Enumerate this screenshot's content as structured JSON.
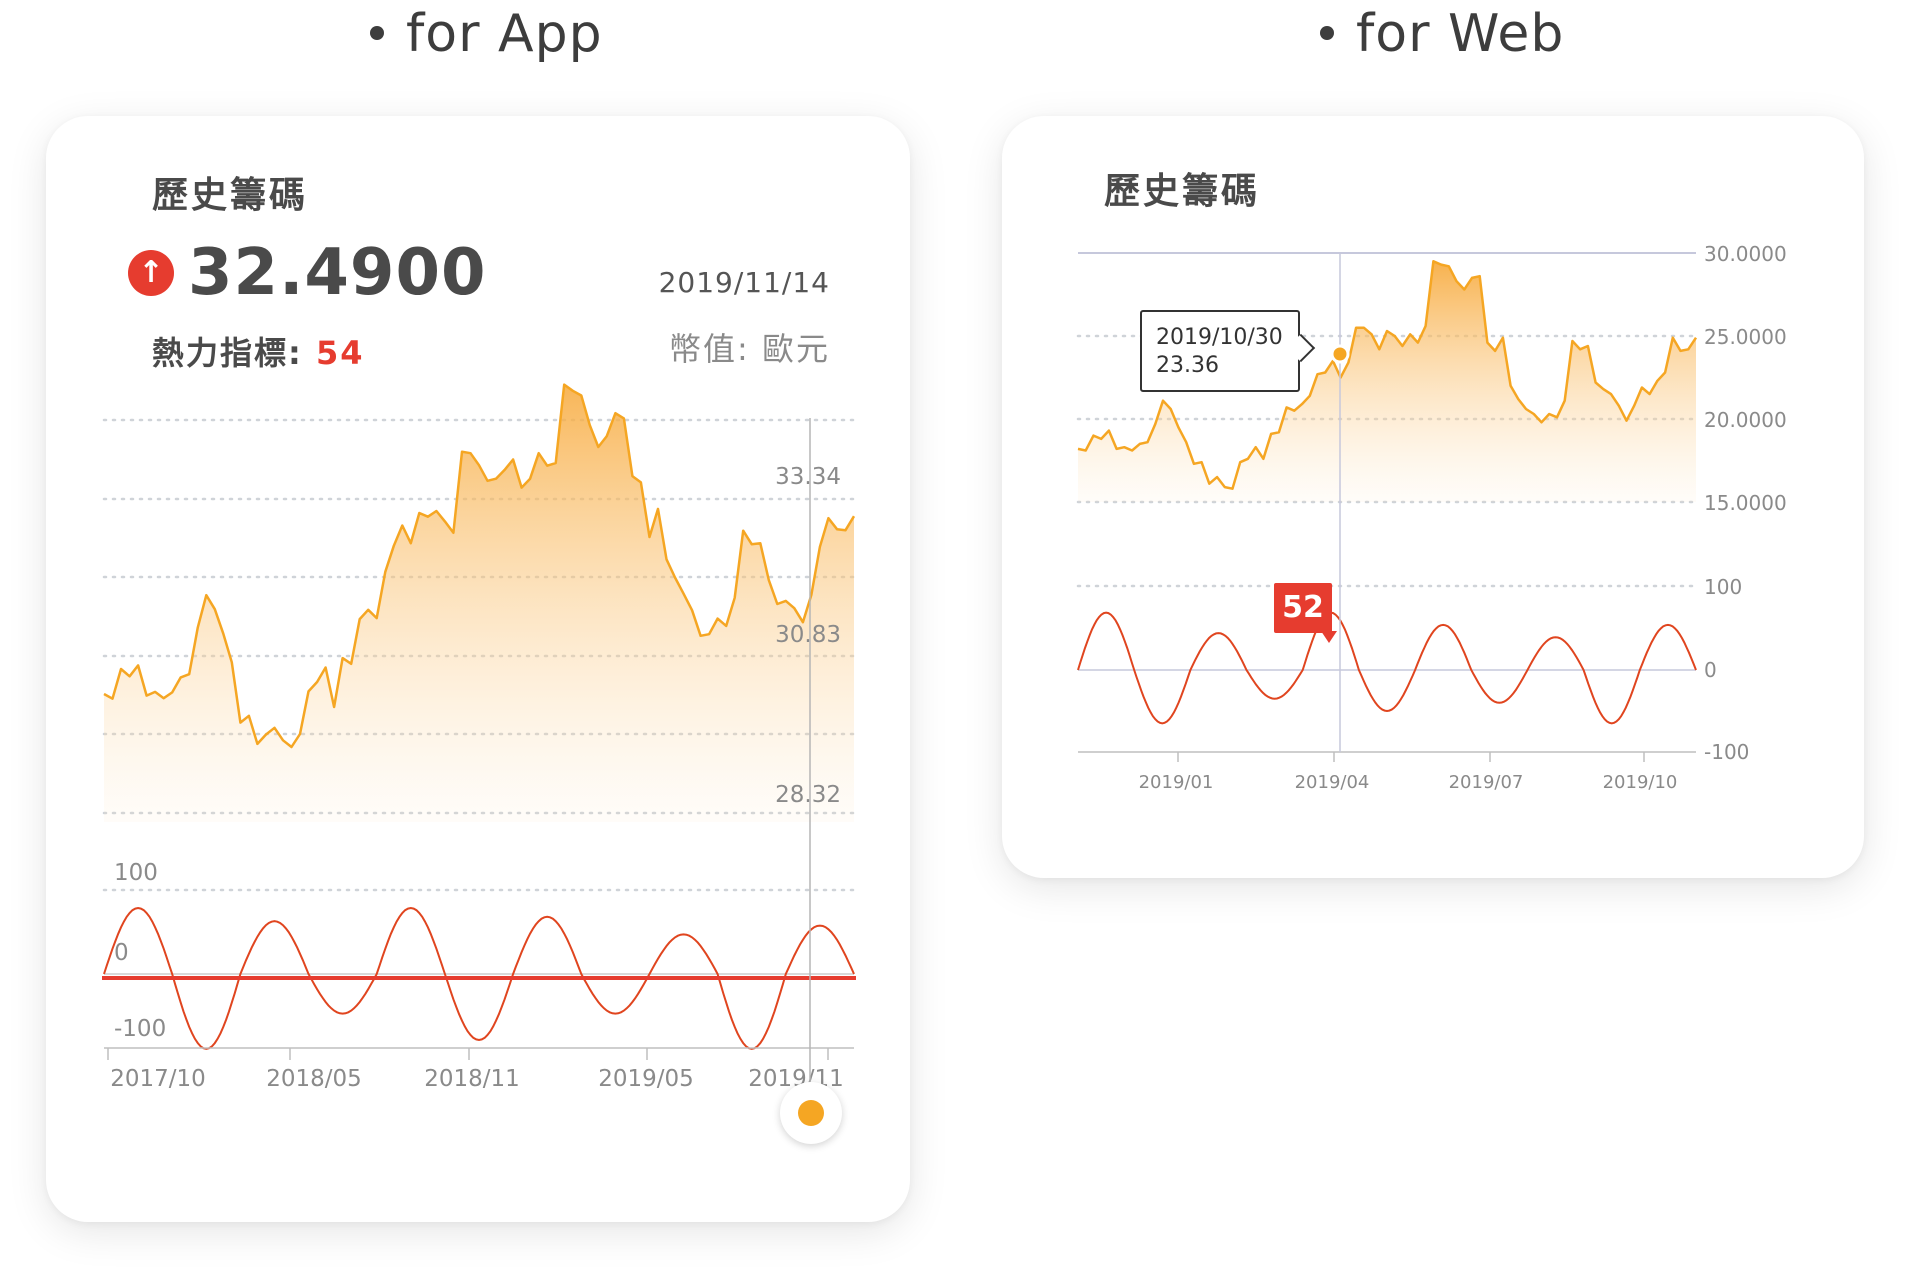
{
  "headings": {
    "app": "for App",
    "web": "for Web"
  },
  "app_card": {
    "title": "歷史籌碼",
    "up_icon": "↑",
    "price": "32.4900",
    "date": "2019/11/14",
    "heat_label": "熱力指標:",
    "heat_value": "54",
    "currency": "幣值: 歐元"
  },
  "web_card": {
    "title": "歷史籌碼",
    "tooltip_date": "2019/10/30",
    "tooltip_value": "23.36",
    "badge_value": "52"
  },
  "colors": {
    "line": "#f5a623",
    "fill_top": "#f9b24a",
    "osc": "#e0451f",
    "red": "#e63c2f",
    "grid": "#cfd3d8",
    "text": "#8a8a8a"
  },
  "chart_data": [
    {
      "type": "area",
      "panel": "app-price",
      "x_tick_labels": [
        "2017/10",
        "2018/05",
        "2018/11",
        "2019/05",
        "2019/11"
      ],
      "y_tick_labels": [
        "33.34",
        "30.83",
        "28.32"
      ],
      "ylim": [
        26.0,
        35.5
      ],
      "grid": true,
      "values": [
        28.82,
        28.73,
        29.3,
        29.16,
        29.37,
        28.79,
        28.86,
        28.74,
        28.85,
        29.14,
        29.2,
        30.1,
        30.72,
        30.45,
        29.98,
        29.43,
        28.27,
        28.4,
        27.86,
        28.04,
        28.17,
        27.93,
        27.8,
        28.05,
        28.87,
        29.05,
        29.33,
        28.57,
        29.51,
        29.4,
        30.26,
        30.44,
        30.28,
        31.17,
        31.67,
        32.06,
        31.72,
        32.3,
        32.23,
        32.34,
        32.14,
        31.92,
        33.48,
        33.45,
        33.22,
        32.92,
        32.96,
        33.13,
        33.33,
        32.79,
        32.96,
        33.45,
        33.21,
        33.26,
        34.77,
        34.65,
        34.56,
        33.99,
        33.57,
        33.78,
        34.22,
        34.12,
        33.01,
        32.89,
        31.84,
        32.38,
        31.41,
        31.06,
        30.75,
        30.43,
        29.94,
        29.97,
        30.27,
        30.13,
        30.67,
        31.96,
        31.7,
        31.72,
        31.01,
        30.55,
        30.61,
        30.47,
        30.2,
        30.73,
        31.65,
        32.2,
        31.99,
        31.97,
        32.24
      ],
      "x_range": "2017/10 – 2019/11"
    },
    {
      "type": "line",
      "panel": "app-oscillator",
      "y_tick_labels": [
        "100",
        "0",
        "-100"
      ],
      "ylim": [
        -130,
        130
      ],
      "amplitudes": [
        75,
        -85,
        60,
        -45,
        75,
        -75,
        65,
        -45,
        45,
        -85,
        55
      ],
      "marker_line_value": -25
    },
    {
      "type": "area",
      "panel": "web-price",
      "x_tick_labels": [
        "2019/01",
        "2019/04",
        "2019/07",
        "2019/10"
      ],
      "y_tick_labels": [
        "30.0000",
        "25.0000",
        "20.0000",
        "15.0000"
      ],
      "ylim": [
        15,
        30
      ],
      "grid": true,
      "values": [
        18.2,
        18.1,
        19.0,
        18.8,
        19.3,
        18.2,
        18.3,
        18.1,
        18.5,
        18.6,
        19.7,
        21.1,
        20.6,
        19.5,
        18.6,
        17.3,
        17.4,
        16.1,
        16.5,
        15.9,
        15.8,
        17.4,
        17.6,
        18.3,
        17.6,
        19.1,
        19.2,
        20.7,
        20.5,
        20.9,
        21.4,
        22.7,
        22.8,
        23.5,
        22.5,
        23.4,
        25.5,
        25.5,
        25.1,
        24.2,
        25.3,
        25.0,
        24.4,
        25.1,
        24.6,
        25.6,
        29.5,
        29.3,
        29.2,
        28.3,
        27.8,
        28.5,
        28.6,
        24.6,
        24.1,
        24.9,
        22.0,
        21.2,
        20.6,
        20.3,
        19.8,
        20.3,
        20.1,
        21.1,
        24.7,
        24.2,
        24.4,
        22.2,
        21.8,
        21.5,
        20.8,
        19.9,
        20.8,
        21.9,
        21.5,
        22.3,
        22.8,
        24.9,
        24.1,
        24.2,
        24.9
      ],
      "x_range": "2018/11 – 2019/11",
      "highlight": {
        "x": "2019/10/30",
        "y": 23.36
      }
    },
    {
      "type": "line",
      "panel": "web-oscillator",
      "y_tick_labels": [
        "100",
        "0",
        "-100"
      ],
      "ylim": [
        -100,
        100
      ],
      "amplitudes": [
        70,
        -65,
        45,
        -35,
        70,
        -50,
        55,
        -40,
        40,
        -65,
        55
      ],
      "highlight_value": 52
    }
  ]
}
